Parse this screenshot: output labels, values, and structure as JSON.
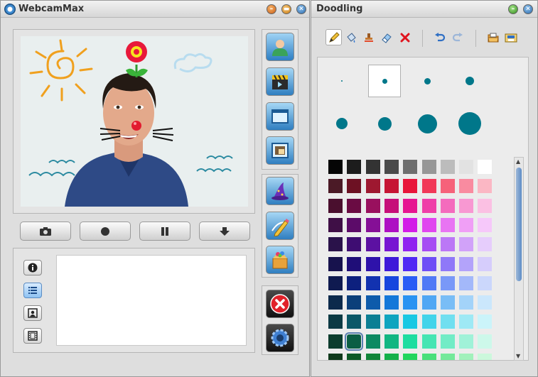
{
  "main_window": {
    "title": "WebcamMax",
    "side_buttons": [
      {
        "name": "person-effects-button",
        "icon": "person-icon"
      },
      {
        "name": "video-clip-button",
        "icon": "clapper-icon"
      },
      {
        "name": "window-frame-button",
        "icon": "frame-window-icon"
      },
      {
        "name": "picture-in-picture-button",
        "icon": "picture-in-picture-icon"
      },
      {
        "name": "magic-effects-button",
        "icon": "wizard-hat-icon"
      },
      {
        "name": "doodle-button",
        "icon": "pencil-icon"
      },
      {
        "name": "gift-box-button",
        "icon": "gift-box-icon"
      },
      {
        "name": "close-effects-button",
        "icon": "close-icon"
      },
      {
        "name": "settings-button",
        "icon": "gear-icon"
      }
    ],
    "controls": [
      "camera-icon",
      "record-icon",
      "pause-icon",
      "download-icon"
    ],
    "view_buttons": [
      "info-icon",
      "list-icon",
      "portrait-icon",
      "film-icon"
    ]
  },
  "doodle_window": {
    "title": "Doodling",
    "tools": [
      "pencil-icon",
      "fill-bucket-icon",
      "stamp-icon",
      "eraser-icon",
      "delete-icon",
      "undo-icon",
      "redo-icon",
      "open-folder-icon",
      "save-icon"
    ],
    "brush_sizes": [
      2,
      7,
      9,
      12,
      16,
      19,
      27,
      32
    ],
    "selected_brush_index": 1,
    "palette": [
      [
        "#050505",
        "#1c1c1c",
        "#333333",
        "#4a4a4a",
        "#6e6e6e",
        "#979797",
        "#bcbcbc",
        "#e2e2e2",
        "#ffffff"
      ],
      [
        "#4b1a26",
        "#6d1123",
        "#9e1830",
        "#c61534",
        "#e8153a",
        "#f13858",
        "#f6627a",
        "#f98ba0",
        "#fbb7c4"
      ],
      [
        "#4a0f2e",
        "#6a0b43",
        "#99105e",
        "#c60f79",
        "#e61691",
        "#ef3fa8",
        "#f46bbd",
        "#f898d2",
        "#fbc0e3"
      ],
      [
        "#3f0f46",
        "#5c0b69",
        "#850f96",
        "#ad10c3",
        "#d21ce7",
        "#e046ef",
        "#e874f3",
        "#f09ff6",
        "#f6c8fa"
      ],
      [
        "#2a124a",
        "#3e0d72",
        "#5c11a2",
        "#7716d2",
        "#9023f0",
        "#a64cf3",
        "#bb77f6",
        "#d1a2f9",
        "#e6cdfc"
      ],
      [
        "#17124d",
        "#1f0e78",
        "#2e12aa",
        "#3e1ad9",
        "#5029f4",
        "#6e4ef6",
        "#8f78f8",
        "#b3a3fa",
        "#d6cdfc"
      ],
      [
        "#0f1a50",
        "#0d207e",
        "#1232b0",
        "#1746de",
        "#2a5cf5",
        "#5079f6",
        "#7998f8",
        "#a3b8fa",
        "#cbd7fc"
      ],
      [
        "#0c2a4c",
        "#0b3f7a",
        "#0e5bab",
        "#1478d9",
        "#2a93f2",
        "#50a7f4",
        "#79bdf6",
        "#a3d3f9",
        "#cbe7fc"
      ],
      [
        "#0c3a44",
        "#0b5868",
        "#0c7f94",
        "#0fa5bf",
        "#19c8e3",
        "#42d4ea",
        "#70dff0",
        "#9ee9f5",
        "#cbf4fa"
      ],
      [
        "#0c3d2e",
        "#0b5e44",
        "#0d8a62",
        "#11b682",
        "#1ddda0",
        "#45e5b3",
        "#72ecc6",
        "#a0f2d8",
        "#cdf8ea"
      ],
      [
        "#0f3a1c",
        "#0d5a27",
        "#108538",
        "#14b04a",
        "#22d65e",
        "#48e07b",
        "#74e99a",
        "#a1f1bb",
        "#ccf8dc"
      ]
    ],
    "selected_color": "#0b5e44"
  }
}
